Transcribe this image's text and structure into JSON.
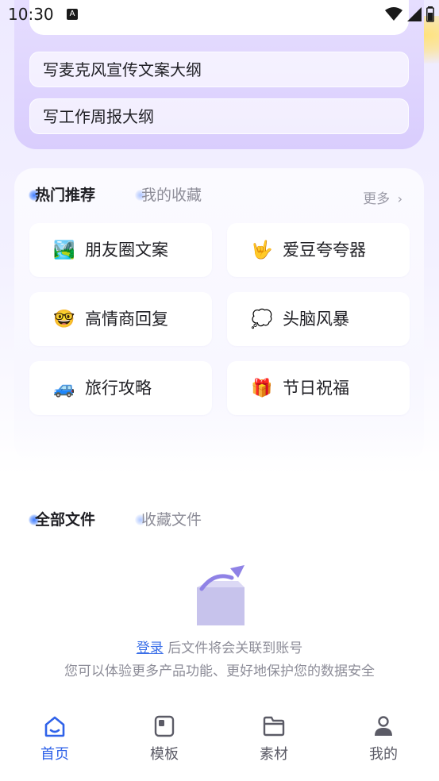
{
  "status_bar": {
    "time": "10:30",
    "notification": "A"
  },
  "prompt_panel": {
    "suggestions": [
      "写麦克风宣传文案大纲",
      "写工作周报大纲"
    ]
  },
  "recommend": {
    "tabs": [
      {
        "label": "热门推荐",
        "active": true
      },
      {
        "label": "我的收藏",
        "active": false
      }
    ],
    "more_label": "更多",
    "items": [
      {
        "emoji": "🏞️",
        "label": "朋友圈文案"
      },
      {
        "emoji": "🤟",
        "label": "爱豆夸夸器"
      },
      {
        "emoji": "🤓",
        "label": "高情商回复"
      },
      {
        "emoji": "💭",
        "label": "头脑风暴"
      },
      {
        "emoji": "🚙",
        "label": "旅行攻略"
      },
      {
        "emoji": "🎁",
        "label": "节日祝福"
      }
    ]
  },
  "files": {
    "tabs": [
      {
        "label": "全部文件",
        "active": true
      },
      {
        "label": "收藏文件",
        "active": false
      }
    ],
    "login_link": "登录",
    "login_text": "后文件将会关联到账号",
    "login_sub": "您可以体验更多产品功能、更好地保护您的数据安全"
  },
  "bottom_nav": [
    {
      "label": "首页",
      "icon": "home-icon",
      "active": true
    },
    {
      "label": "模板",
      "icon": "template-icon",
      "active": false
    },
    {
      "label": "素材",
      "icon": "folder-icon",
      "active": false
    },
    {
      "label": "我的",
      "icon": "profile-icon",
      "active": false
    }
  ],
  "colors": {
    "accent": "#2f62e9",
    "panel": "#d9cdfd",
    "muted": "#8d8d98"
  }
}
